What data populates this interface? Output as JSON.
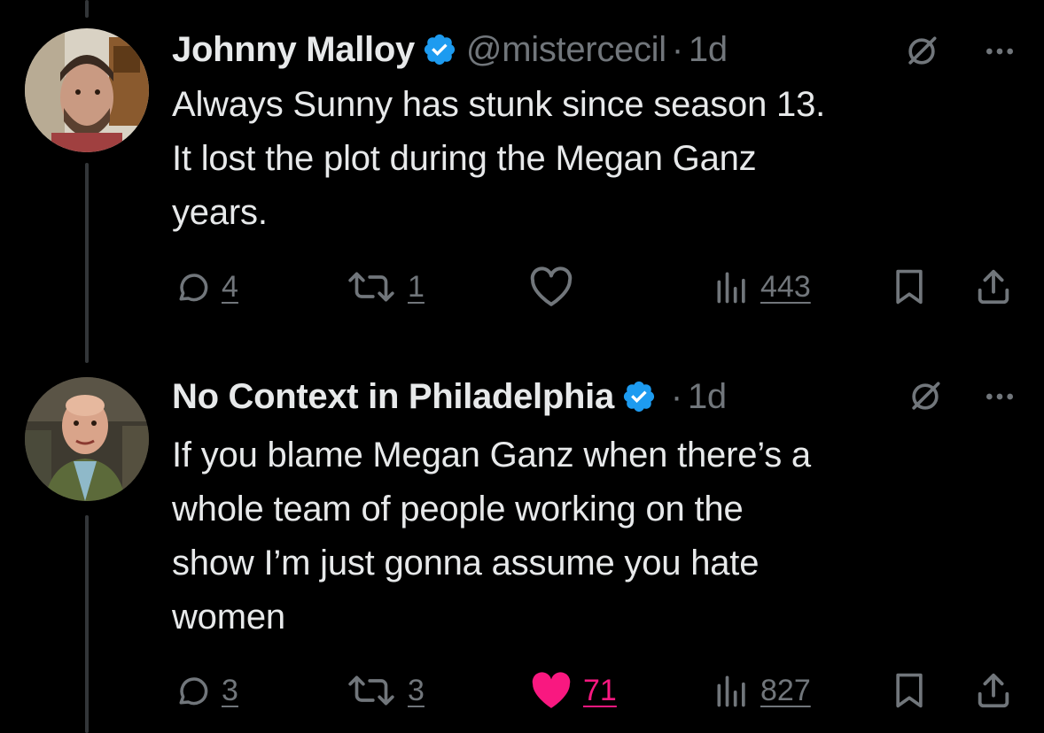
{
  "colors": {
    "background": "#000000",
    "primary_text": "#e7e9ea",
    "secondary_text": "#71767b",
    "verified_blue": "#1d9bf0",
    "like_pink": "#f91880",
    "thread_line": "#333639"
  },
  "tweets": [
    {
      "author_name": "Johnny Malloy",
      "verified": true,
      "handle": "@mistercecil",
      "separator": "·",
      "time": "1d",
      "text_lines": [
        "Always Sunny has stunk since season 13.",
        "It lost the plot during the Megan Ganz",
        "years."
      ],
      "actions": {
        "replies": "4",
        "reposts": "1",
        "likes": "",
        "liked": false,
        "views": "443"
      },
      "icons": [
        "reply-icon",
        "repost-icon",
        "like-icon",
        "views-icon",
        "bookmark-icon",
        "share-icon",
        "grok-icon",
        "more-icon"
      ]
    },
    {
      "author_name": "No Context in Philadelphia",
      "verified": true,
      "handle": "",
      "separator": "·",
      "time": "1d",
      "text_lines": [
        "If you blame Megan Ganz when there’s a",
        "whole team of people working on the",
        "show I’m just gonna assume you hate",
        "women"
      ],
      "actions": {
        "replies": "3",
        "reposts": "3",
        "likes": "71",
        "liked": true,
        "views": "827"
      },
      "icons": [
        "reply-icon",
        "repost-icon",
        "like-icon",
        "views-icon",
        "bookmark-icon",
        "share-icon",
        "grok-icon",
        "more-icon"
      ]
    }
  ]
}
